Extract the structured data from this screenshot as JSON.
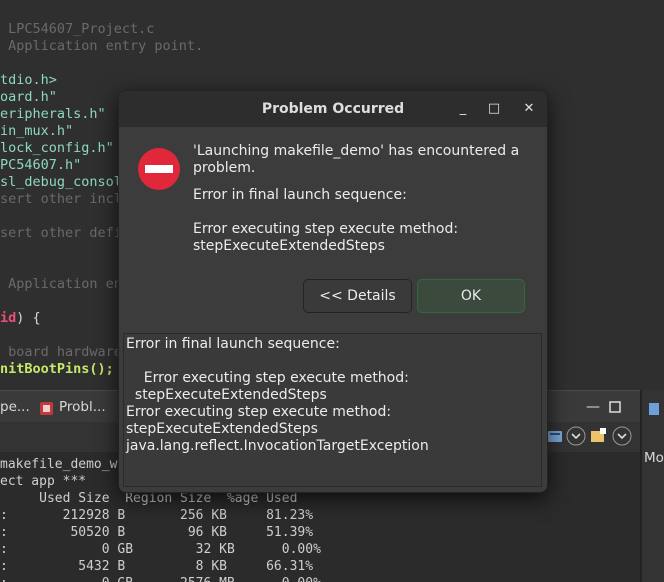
{
  "editor": {
    "lines": [
      {
        "text": " LPC54607_Project.c",
        "cls": "c-comment"
      },
      {
        "text": " Application entry point.",
        "cls": "c-comment"
      },
      {
        "text": "",
        "cls": "c-default"
      },
      {
        "text": "tdio.h>",
        "cls": "c-include"
      },
      {
        "text": "oard.h\"",
        "cls": "c-include"
      },
      {
        "text": "eripherals.h\"",
        "cls": "c-include"
      },
      {
        "text": "in_mux.h\"",
        "cls": "c-include"
      },
      {
        "text": "lock_config.h\"",
        "cls": "c-include"
      },
      {
        "text": "PC54607.h\"",
        "cls": "c-include"
      },
      {
        "text": "sl_debug_consol",
        "cls": "c-include"
      },
      {
        "text": "sert other incl",
        "cls": "c-comment"
      },
      {
        "text": "",
        "cls": "c-default"
      },
      {
        "text": "sert other defi",
        "cls": "c-comment"
      },
      {
        "text": "",
        "cls": "c-default"
      },
      {
        "text": "",
        "cls": "c-default"
      },
      {
        "text": " Application en",
        "cls": "c-comment"
      },
      {
        "text": "",
        "cls": "c-default"
      },
      {
        "text": "id) {",
        "cls": "c-default"
      },
      {
        "text": "",
        "cls": "c-default"
      },
      {
        "text": " board hardware",
        "cls": "c-comment"
      },
      {
        "text": "nitBootPins();",
        "cls": "c-func"
      },
      {
        "text": "",
        "cls": "c-default"
      }
    ],
    "void_kw": "id",
    "brace": ") {"
  },
  "panel": {
    "tab_pe": "pe...",
    "tab_problems": "Probl...",
    "right_tab": "Mo"
  },
  "console": {
    "lines": [
      "makefile_demo_w",
      "ect app ***",
      "     Used Size  Region Size  %age Used",
      ":       212928 B       256 KB     81.23%",
      ":        50520 B        96 KB     51.39%",
      ":            0 GB        32 KB      0.00%",
      ":         5432 B         8 KB     66.31%",
      ":            0 GB      2576 MB      0.00%"
    ]
  },
  "dialog": {
    "title": "Problem Occurred",
    "minimize": "_",
    "maximize": "□",
    "close": "✕",
    "message_line1": "'Launching makefile_demo' has encountered a",
    "message_line2": "problem.",
    "reason": "Error in final launch sequence:",
    "detail_line1": "Error executing step execute method:",
    "detail_line2": "stepExecuteExtendedSteps",
    "details_button": "<< Details",
    "ok_button": "OK",
    "details": [
      "Error in final launch sequence:",
      "",
      "    Error executing step execute method:",
      "  stepExecuteExtendedSteps",
      "Error executing step execute method:",
      "stepExecuteExtendedSteps",
      "java.lang.reflect.InvocationTargetException"
    ],
    "colors": {
      "error_red": "#e0283a",
      "ok_border": "#2e6a3c"
    }
  }
}
